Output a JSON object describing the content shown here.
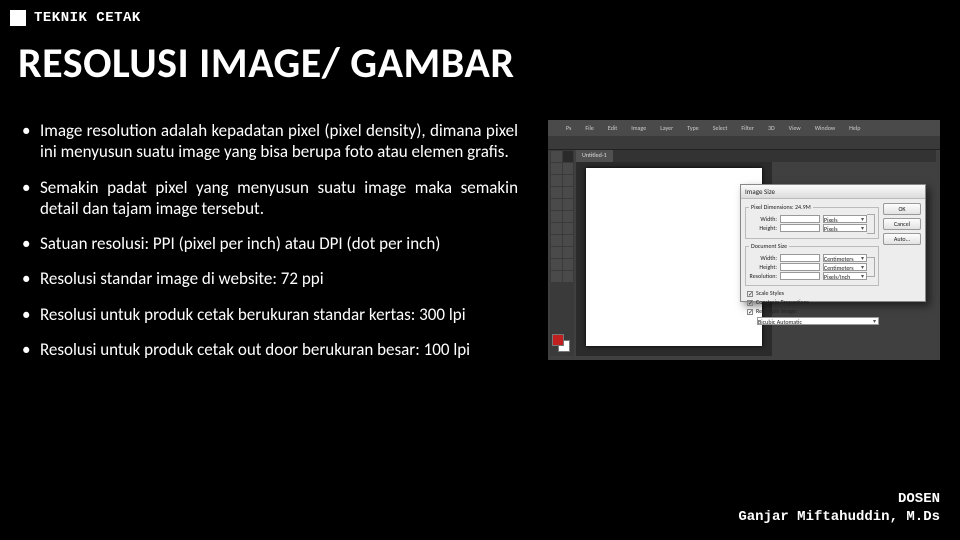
{
  "header": {
    "label": "TEKNIK CETAK"
  },
  "title": "RESOLUSI IMAGE/ GAMBAR",
  "bullets": [
    "Image resolution adalah kepadatan pixel (pixel density), dimana pixel ini menyusun suatu image yang bisa berupa foto atau elemen grafis.",
    "Semakin padat pixel yang menyusun suatu image maka semakin detail dan tajam image tersebut.",
    "Satuan resolusi: PPI (pixel per inch) atau DPI (dot per inch)",
    "Resolusi standar image di website: 72 ppi",
    "Resolusi untuk produk cetak berukuran standar kertas: 300 lpi",
    "Resolusi untuk produk cetak out door berukuran besar: 100 lpi"
  ],
  "figure": {
    "menus": [
      "File",
      "Edit",
      "Image",
      "Layer",
      "Type",
      "Select",
      "Filter",
      "3D",
      "View",
      "Window",
      "Help"
    ],
    "tab": "Untitled-1",
    "dialog": {
      "title": "Image Size",
      "dimensions_label": "Pixel Dimensions: 24.9M",
      "width_label": "Width:",
      "height_label": "Height:",
      "docsize_label": "Document Size",
      "resolution_label": "Resolution:",
      "unit_px": "Pixels",
      "unit_cm": "Centimeters",
      "unit_ppi": "Pixels/Inch",
      "check_scale": "Scale Styles",
      "check_constrain": "Constrain Proportions",
      "check_resample": "Resample Image:",
      "resample_method": "Bicubic Automatic",
      "btn_ok": "OK",
      "btn_cancel": "Cancel",
      "btn_auto": "Auto..."
    }
  },
  "footer": {
    "line1": "DOSEN",
    "line2": "Ganjar Miftahuddin, M.Ds"
  }
}
